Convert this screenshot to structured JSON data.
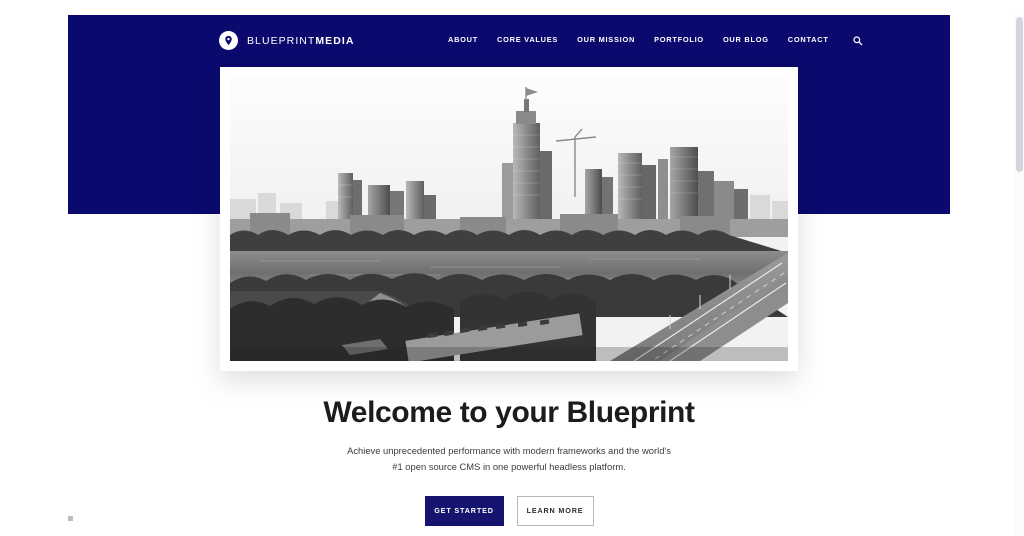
{
  "site": {
    "brand": {
      "icon": "map-pin-icon",
      "name_light": "BLUEPRINT",
      "name_bold": "MEDIA"
    },
    "nav": {
      "items": [
        {
          "label": "ABOUT"
        },
        {
          "label": "CORE VALUES"
        },
        {
          "label": "OUR MISSION"
        },
        {
          "label": "PORTFOLIO"
        },
        {
          "label": "OUR BLOG"
        },
        {
          "label": "CONTACT"
        }
      ],
      "search_icon": "search-icon"
    }
  },
  "hero": {
    "image_alt": "Black and white aerial cityscape of a downtown skyline with a river, park and bridge"
  },
  "welcome": {
    "title": "Welcome to your Blueprint",
    "subtitle": "Achieve unprecedented performance with modern frameworks and the world's #1 open source CMS in one powerful headless platform.",
    "primary_cta": "GET STARTED",
    "secondary_cta": "LEARN MORE"
  },
  "colors": {
    "navy": "#0a0a6e",
    "button_navy": "#151570",
    "heading": "#1c1c1c",
    "body_text": "#3c3c3c",
    "border": "#b9b9b9"
  }
}
